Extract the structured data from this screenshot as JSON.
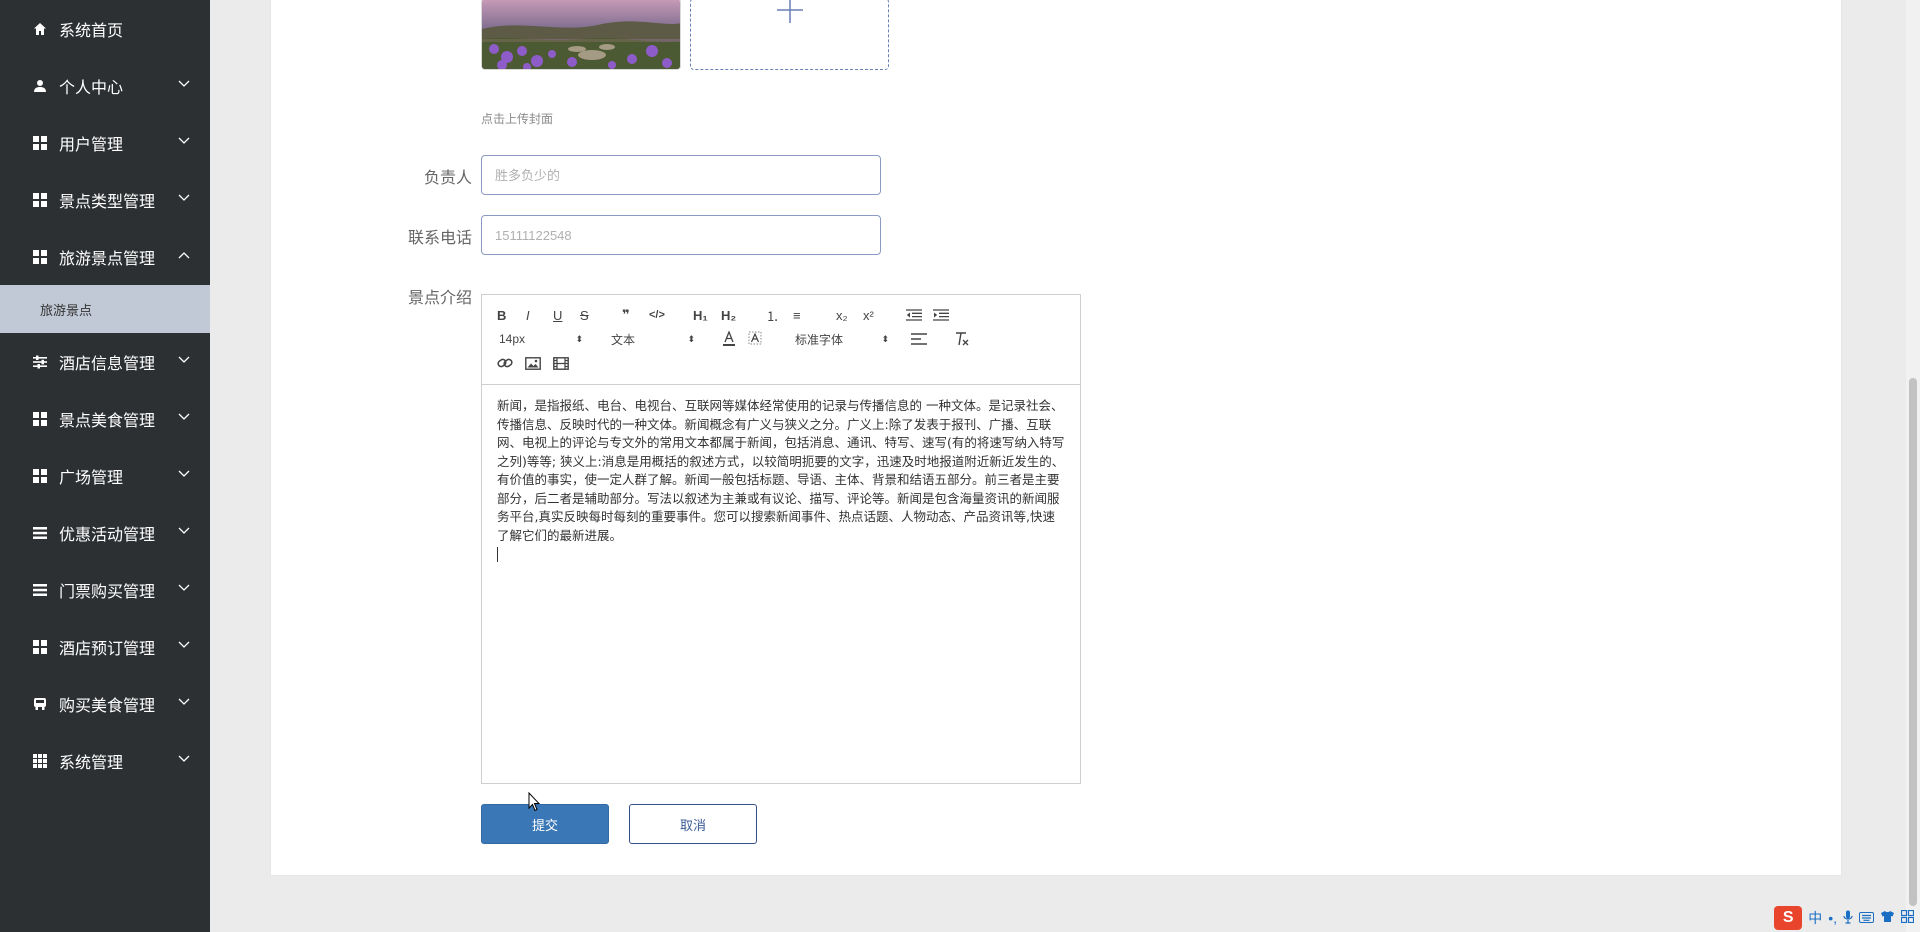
{
  "sidebar": {
    "items": [
      {
        "label": "系统首页",
        "icon": "home-icon"
      },
      {
        "label": "个人中心",
        "icon": "user-icon"
      },
      {
        "label": "用户管理",
        "icon": "grid-icon"
      },
      {
        "label": "景点类型管理",
        "icon": "grid-icon"
      },
      {
        "label": "旅游景点管理",
        "icon": "grid-icon"
      },
      {
        "label": "酒店信息管理",
        "icon": "sliders-icon"
      },
      {
        "label": "景点美食管理",
        "icon": "grid-icon"
      },
      {
        "label": "广场管理",
        "icon": "grid-icon"
      },
      {
        "label": "优惠活动管理",
        "icon": "list-icon"
      },
      {
        "label": "门票购买管理",
        "icon": "list-icon"
      },
      {
        "label": "酒店预订管理",
        "icon": "grid-icon"
      },
      {
        "label": "购买美食管理",
        "icon": "bus-icon"
      },
      {
        "label": "系统管理",
        "icon": "apps-icon"
      }
    ],
    "active_sub": "旅游景点"
  },
  "form": {
    "upload_tip": "点击上传封面",
    "manager": {
      "label": "负责人",
      "placeholder": "胜多负少的"
    },
    "phone": {
      "label": "联系电话",
      "placeholder": "15111122548"
    },
    "intro": {
      "label": "景点介绍"
    }
  },
  "editor": {
    "toolbar": {
      "bold": "B",
      "italic": "I",
      "underline": "U",
      "strike": "S",
      "quote": "❞",
      "code": "</>",
      "h1": "H₁",
      "h2": "H₂",
      "ol": "⒈",
      "ul": "≡",
      "sub": "x₂",
      "sup": "x²",
      "font_size": "14px",
      "text_type": "文本",
      "font_family": "标准字体",
      "align": "≡",
      "clear": "Tx"
    },
    "content": "新闻，是指报纸、电台、电视台、互联网等媒体经常使用的记录与传播信息的 一种文体。是记录社会、传播信息、反映时代的一种文体。新闻概念有广义与狭义之分。广义上:除了发表于报刊、广播、互联网、电视上的评论与专文外的常用文本都属于新闻，包括消息、通讯、特写、速写(有的将速写纳入特写之列)等等; 狭义上:消息是用概括的叙述方式，以较简明扼要的文字，迅速及时地报道附近新近发生的、有价值的事实，使一定人群了解。新闻一般包括标题、导语、主体、背景和结语五部分。前三者是主要部分，后二者是辅助部分。写法以叙述为主兼或有议论、描写、评论等。新闻是包含海量资讯的新闻服务平台,真实反映每时每刻的重要事件。您可以搜索新闻事件、热点话题、人物动态、产品资讯等,快速了解它们的最新进展。"
  },
  "buttons": {
    "submit": "提交",
    "cancel": "取消"
  },
  "ime": {
    "lang": "中",
    "punct": "•,"
  },
  "colors": {
    "sidebar_bg": "#2d3033",
    "submenu_bg": "#c1c9d6",
    "primary": "#3a77b6"
  }
}
